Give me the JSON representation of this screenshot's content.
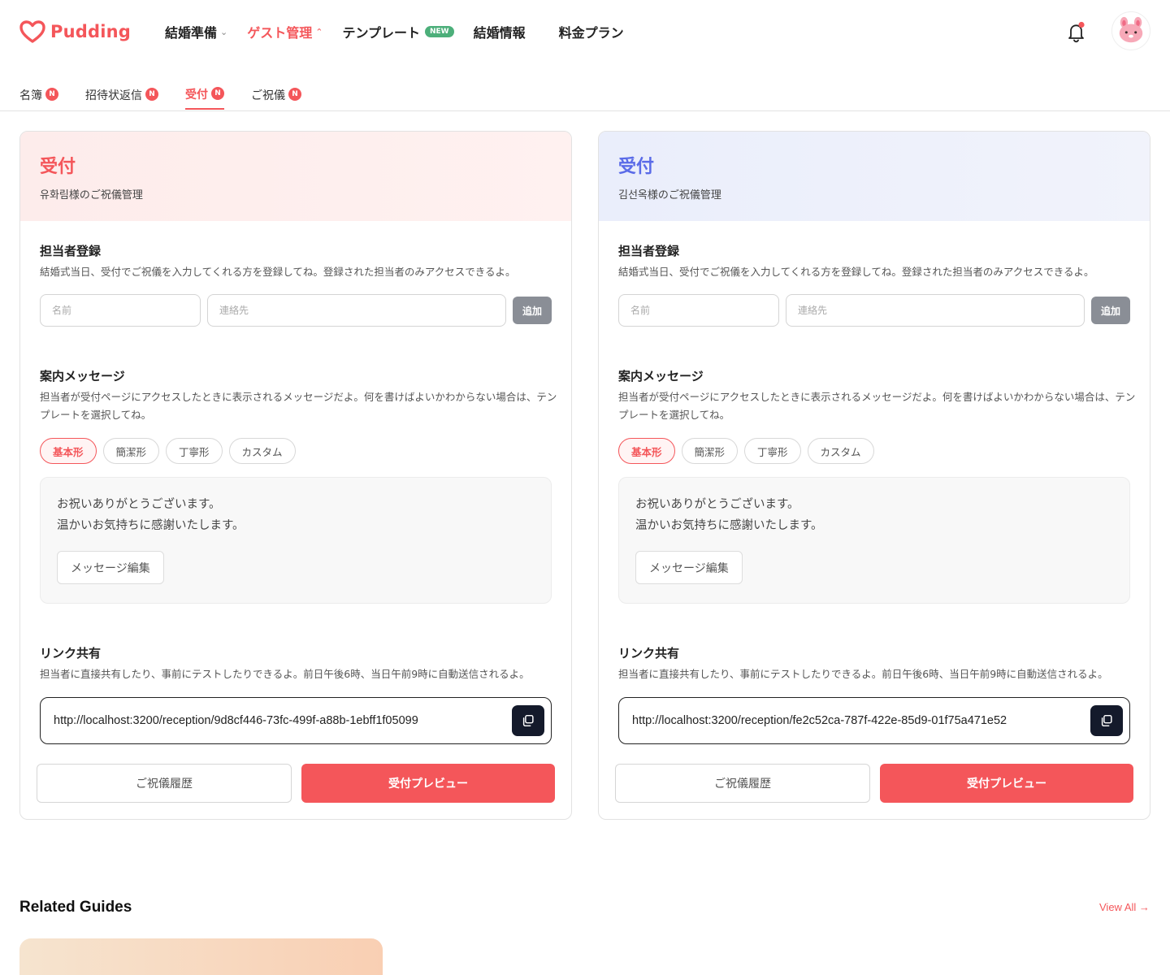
{
  "header": {
    "logo_text": "Pudding",
    "nav": [
      {
        "label": "結婚準備",
        "chevron": "⌄"
      },
      {
        "label": "ゲスト管理",
        "chevron": "⌃"
      },
      {
        "label": "テンプレート",
        "badge": "NEW"
      },
      {
        "label": "結婚情報"
      },
      {
        "label": "料金プラン"
      }
    ]
  },
  "tabs": [
    {
      "label": "名簿",
      "badge": "N"
    },
    {
      "label": "招待状返信",
      "badge": "N"
    },
    {
      "label": "受付",
      "badge": "N"
    },
    {
      "label": "ご祝儀",
      "badge": "N"
    }
  ],
  "cards": [
    {
      "title": "受付",
      "subtitle": "유화림様のご祝儀管理",
      "staff_title": "担当者登録",
      "staff_desc": "結婚式当日、受付でご祝儀を入力してくれる方を登録してね。登録された担当者のみアクセスできるよ。",
      "name_placeholder": "名前",
      "contact_placeholder": "連絡先",
      "add_label": "追加",
      "msg_title": "案内メッセージ",
      "msg_desc": "担当者が受付ページにアクセスしたときに表示されるメッセージだよ。何を書けばよいかわからない場合は、テンプレートを選択してね。",
      "chips": [
        "基本形",
        "簡潔形",
        "丁寧形",
        "カスタム"
      ],
      "msg_line1": "お祝いありがとうございます。",
      "msg_line2": "温かいお気持ちに感謝いたします。",
      "edit_label": "メッセージ編集",
      "link_title": "リンク共有",
      "link_desc": "担当者に直接共有したり、事前にテストしたりできるよ。前日午後6時、当日午前9時に自動送信されるよ。",
      "link_url": "http://localhost:3200/reception/9d8cf446-73fc-499f-a88b-1ebff1f05099",
      "history_label": "ご祝儀履歴",
      "preview_label": "受付プレビュー"
    },
    {
      "title": "受付",
      "subtitle": "김선옥様のご祝儀管理",
      "staff_title": "担当者登録",
      "staff_desc": "結婚式当日、受付でご祝儀を入力してくれる方を登録してね。登録された担当者のみアクセスできるよ。",
      "name_placeholder": "名前",
      "contact_placeholder": "連絡先",
      "add_label": "追加",
      "msg_title": "案内メッセージ",
      "msg_desc": "担当者が受付ページにアクセスしたときに表示されるメッセージだよ。何を書けばよいかわからない場合は、テンプレートを選択してね。",
      "chips": [
        "基本形",
        "簡潔形",
        "丁寧形",
        "カスタム"
      ],
      "msg_line1": "お祝いありがとうございます。",
      "msg_line2": "温かいお気持ちに感謝いたします。",
      "edit_label": "メッセージ編集",
      "link_title": "リンク共有",
      "link_desc": "担当者に直接共有したり、事前にテストしたりできるよ。前日午後6時、当日午前9時に自動送信されるよ。",
      "link_url": "http://localhost:3200/reception/fe2c52ca-787f-422e-85d9-01f75a471e52",
      "history_label": "ご祝儀履歴",
      "preview_label": "受付プレビュー"
    }
  ],
  "related": {
    "title": "Related Guides",
    "view_all": "View All →"
  },
  "colors": {
    "accent": "#f4565a",
    "blue_accent": "#5a6be8",
    "new_badge": "#4caf7a",
    "copy_button": "#141a2b"
  }
}
